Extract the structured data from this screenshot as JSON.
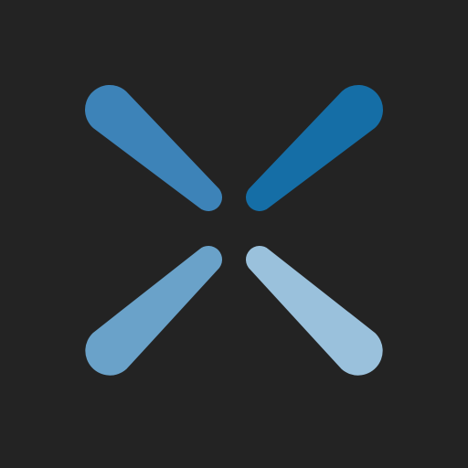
{
  "icon": {
    "name": "pinwheel-x-logo-icon",
    "background_color": "#232323",
    "petals": [
      {
        "name": "petal-top-left",
        "color": "#3d83b8"
      },
      {
        "name": "petal-top-right",
        "color": "#156ea6"
      },
      {
        "name": "petal-bottom-left",
        "color": "#6aa2c9"
      },
      {
        "name": "petal-bottom-right",
        "color": "#9ac1dc"
      }
    ]
  }
}
